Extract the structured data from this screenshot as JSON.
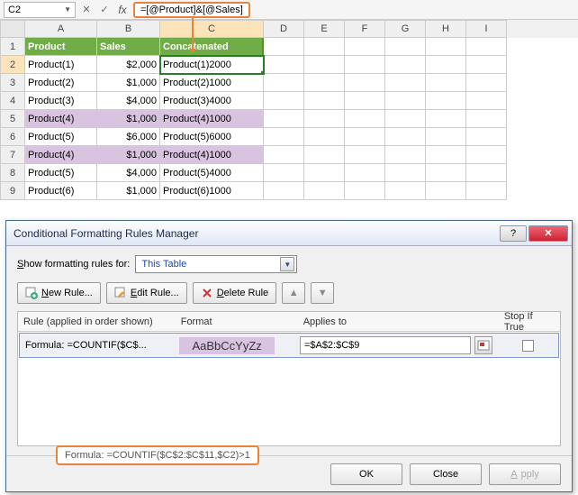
{
  "formula_bar": {
    "name_box": "C2",
    "formula": "=[@Product]&[@Sales]"
  },
  "columns": [
    "A",
    "B",
    "C",
    "D",
    "E",
    "F",
    "G",
    "H",
    "I"
  ],
  "headers": {
    "A": "Product",
    "B": "Sales",
    "C": "Concatenated"
  },
  "rows": [
    {
      "n": "1"
    },
    {
      "n": "2",
      "A": "Product(1)",
      "B": "$2,000",
      "C": "Product(1)2000"
    },
    {
      "n": "3",
      "A": "Product(2)",
      "B": "$1,000",
      "C": "Product(2)1000"
    },
    {
      "n": "4",
      "A": "Product(3)",
      "B": "$4,000",
      "C": "Product(3)4000"
    },
    {
      "n": "5",
      "A": "Product(4)",
      "B": "$1,000",
      "C": "Product(4)1000",
      "dup": true
    },
    {
      "n": "6",
      "A": "Product(5)",
      "B": "$6,000",
      "C": "Product(5)6000"
    },
    {
      "n": "7",
      "A": "Product(4)",
      "B": "$1,000",
      "C": "Product(4)1000",
      "dup": true
    },
    {
      "n": "8",
      "A": "Product(5)",
      "B": "$4,000",
      "C": "Product(5)4000"
    },
    {
      "n": "9",
      "A": "Product(6)",
      "B": "$1,000",
      "C": "Product(6)1000"
    }
  ],
  "dialog": {
    "title": "Conditional Formatting Rules Manager",
    "show_label_pre": "S",
    "show_label_post": "how formatting rules for:",
    "scope": "This Table",
    "buttons": {
      "new": "New Rule...",
      "edit": "Edit Rule...",
      "delete": "Delete Rule"
    },
    "grid": {
      "h1": "Rule (applied in order shown)",
      "h2": "Format",
      "h3": "Applies to",
      "h4": "Stop If True",
      "rule_label": "Formula: =COUNTIF($C$...",
      "format_preview": "AaBbCcYyZz",
      "applies_to": "=$A$2:$C$9"
    },
    "tooltip": "Formula: =COUNTIF($C$2:$C$11,$C2)>1",
    "footer": {
      "ok": "OK",
      "close": "Close",
      "apply": "Apply"
    }
  }
}
